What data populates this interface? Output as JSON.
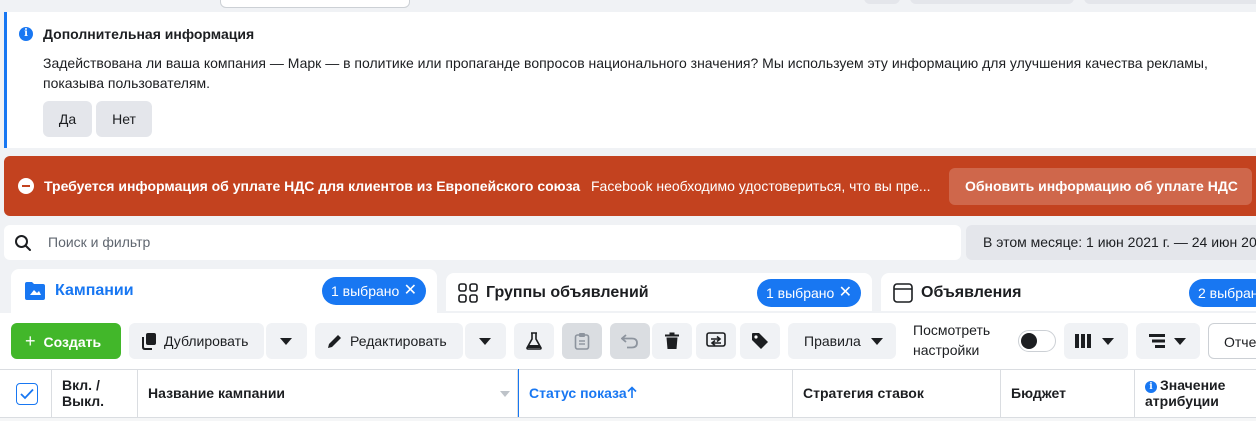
{
  "info_panel": {
    "title": "Дополнительная информация",
    "text": "Задействована ли ваша компания — Марк — в политике или пропаганде вопросов национального значения? Мы используем эту информацию для улучшения качества рекламы, показыва пользователям.",
    "yes_label": "Да",
    "no_label": "Нет"
  },
  "vat_banner": {
    "title": "Требуется информация об уплате НДС для клиентов из Европейского союза",
    "text": "Facebook необходимо удостовериться, что вы пре...",
    "button_label": "Обновить информацию об уплате НДС"
  },
  "search": {
    "placeholder": "Поиск и фильтр",
    "value": ""
  },
  "date_range": {
    "label": "В этом месяце: 1 июн 2021 г. — 24 июн 202"
  },
  "tabs": [
    {
      "label": "Кампании",
      "pill": "1 выбрано",
      "active": true
    },
    {
      "label": "Группы объявлений",
      "pill": "1 выбрано",
      "active": false
    },
    {
      "label": "Объявления",
      "pill": "2 выбран",
      "active": false
    }
  ],
  "toolbar": {
    "create_label": "Создать",
    "duplicate_label": "Дублировать",
    "edit_label": "Редактировать",
    "rules_label": "Правила",
    "view_settings_label": "Посмотреть настройки",
    "reports_label": "Отче"
  },
  "table": {
    "columns": [
      {
        "label": "Вкл. / Выкл."
      },
      {
        "label": "Название кампании"
      },
      {
        "label": "Статус показа"
      },
      {
        "label": "Стратегия ставок"
      },
      {
        "label": "Бюджет"
      },
      {
        "label": "Значение атрибуции"
      }
    ]
  },
  "colors": {
    "accent": "#1877f2",
    "vat_banner": "#c3421f",
    "create_button": "#42b72a",
    "sorted_column": "#1877f2"
  },
  "icons": [
    "info-icon",
    "minus-circle-icon",
    "search-icon",
    "folder-icon",
    "grid-icon",
    "ad-icon",
    "close-icon",
    "plus-icon",
    "duplicate-icon",
    "pencil-icon",
    "flask-icon",
    "clipboard-icon",
    "undo-icon",
    "trash-icon",
    "ab-test-icon",
    "tag-icon",
    "columns-icon",
    "breakdown-icon",
    "check-icon",
    "sort-up-icon"
  ]
}
